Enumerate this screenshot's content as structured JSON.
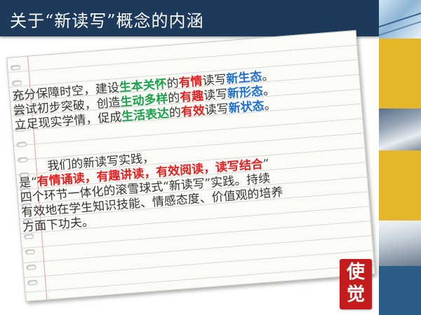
{
  "header": {
    "title": "关于“新读写”概念的内涵"
  },
  "paragraph1": {
    "line1": {
      "p1": "充分保障时空，建设",
      "p2": "生本关怀",
      "p3": "的",
      "p4": "有情",
      "p5": "读写",
      "p6": "新生态",
      "p7": "。"
    },
    "line2": {
      "p1": "尝试初步突破，创造",
      "p2": "生动多样",
      "p3": "的",
      "p4": "有趣",
      "p5": "读写",
      "p6": "新形态",
      "p7": "。"
    },
    "line3": {
      "p1": "立足现实学情，促成",
      "p2": "生活表达",
      "p3": "的",
      "p4": "有效",
      "p5": "读写",
      "p6": "新状态",
      "p7": "。"
    }
  },
  "paragraph2": {
    "line1": "我们的新读写实践，",
    "line2": {
      "p1": "是“",
      "p2": "有情诵读，有趣讲读，有效阅读，读写结合",
      "p3": "”"
    },
    "line3": "四个环节一体化的滚雪球式“新读写”实践。持续",
    "line4": "有效地在学生知识技能、情感态度、价值观的培养",
    "line5": "方面下功夫。"
  },
  "logo": {
    "char1": "使",
    "char2": "觉"
  },
  "colors": {
    "header_bg": "#1d3a5c",
    "green": "#19a24a",
    "red": "#e51f1f",
    "blue": "#1f6fd1",
    "strip_gold": "#e6b62a",
    "strip_blue": "#2c5d86",
    "logo_red": "#c41c1c"
  }
}
